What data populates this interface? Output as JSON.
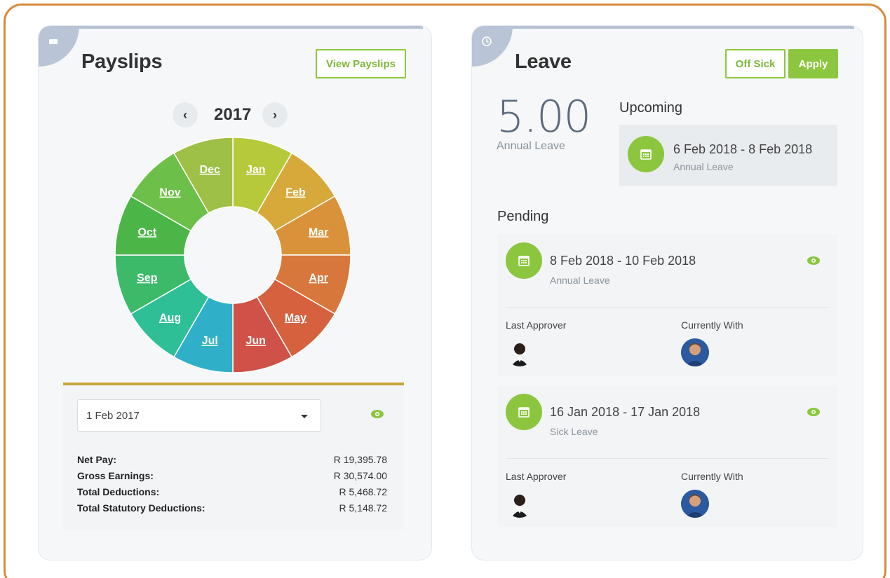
{
  "payslips": {
    "title": "Payslips",
    "view_button": "View Payslips",
    "year": "2017",
    "prev_icon": "chevron-left-icon",
    "next_icon": "chevron-right-icon",
    "months": [
      "Jan",
      "Feb",
      "Mar",
      "Apr",
      "May",
      "Jun",
      "Jul",
      "Aug",
      "Sep",
      "Oct",
      "Nov",
      "Dec"
    ],
    "month_colors": [
      "#b6c93a",
      "#d6a93a",
      "#d9923a",
      "#d8773c",
      "#d5613e",
      "#cf5147",
      "#2fb0c8",
      "#2fbf96",
      "#3cba6a",
      "#4cb548",
      "#6cbf48",
      "#9fc047"
    ],
    "selected_date": "1 Feb 2017",
    "rows": [
      {
        "label": "Net Pay:",
        "value": "R 19,395.78"
      },
      {
        "label": "Gross Earnings:",
        "value": "R 30,574.00"
      },
      {
        "label": "Total Deductions:",
        "value": "R 5,468.72"
      },
      {
        "label": "Total Statutory Deductions:",
        "value": "R 5,148.72"
      }
    ]
  },
  "leave": {
    "title": "Leave",
    "off_sick_button": "Off Sick",
    "apply_button": "Apply",
    "balance": "5.00",
    "balance_label": "Annual Leave",
    "upcoming_heading": "Upcoming",
    "upcoming": {
      "dates": "6 Feb 2018 - 8 Feb 2018",
      "type": "Annual Leave"
    },
    "pending_heading": "Pending",
    "pending": [
      {
        "dates": "8 Feb 2018 - 10 Feb 2018",
        "type": "Annual Leave",
        "last_approver_label": "Last Approver",
        "currently_with_label": "Currently With"
      },
      {
        "dates": "16 Jan 2018 - 17 Jan 2018",
        "type": "Sick Leave",
        "last_approver_label": "Last Approver",
        "currently_with_label": "Currently With"
      }
    ]
  },
  "colors": {
    "accent": "#8cc63f",
    "frame": "#d98a3c",
    "gold": "#c8a33a"
  }
}
